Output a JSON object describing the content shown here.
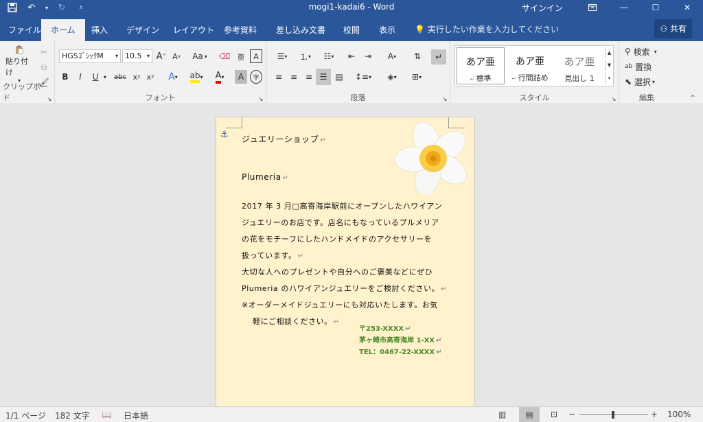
{
  "window": {
    "title": "mogi1-kadai6  -  Word",
    "signin": "サインイン"
  },
  "tabs": [
    "ファイル",
    "ホーム",
    "挿入",
    "デザイン",
    "レイアウト",
    "参考資料",
    "差し込み文書",
    "校閲",
    "表示"
  ],
  "tellme": "実行したい作業を入力してください",
  "share": "共有",
  "ribbon": {
    "clipboard": {
      "paste": "貼り付け",
      "label": "クリップボード"
    },
    "font": {
      "name": "HGSｺﾞｼｯｸM",
      "size": "10.5",
      "label": "フォント",
      "aa": "Aa"
    },
    "paragraph": {
      "label": "段落"
    },
    "styles": {
      "label": "スタイル",
      "items": [
        {
          "preview": "あア亜",
          "name": "標準"
        },
        {
          "preview": "あア亜",
          "name": "行間詰め"
        },
        {
          "preview": "あア亜",
          "name": "見出し 1"
        }
      ]
    },
    "editing": {
      "find": "検索",
      "replace": "置換",
      "select": "選択",
      "label": "編集"
    }
  },
  "document": {
    "heading1": "ジュエリーショップ",
    "heading2": "Plumeria",
    "body": [
      "2017 年 3 月□高寄海岸駅前にオープンしたハワイアン",
      "ジュエリーのお店です。店名にもなっているプルメリア",
      "の花をモチーフにしたハンドメイドのアクセサリーを",
      "扱っています。",
      "大切な人へのプレゼントや自分へのご褒美などにぜひ",
      "Plumeria のハワイアンジュエリーをご検討ください。",
      "※オーダーメイドジュエリーにも対応いたします。お気",
      "軽にご相談ください。"
    ],
    "address": [
      "〒253-XXXX",
      "茅ヶ崎市高寄海岸 1-XX",
      "TEL：0467-22-XXXX"
    ]
  },
  "status": {
    "page": "1/1 ページ",
    "words": "182 文字",
    "lang": "日本語",
    "zoom": "100%"
  }
}
